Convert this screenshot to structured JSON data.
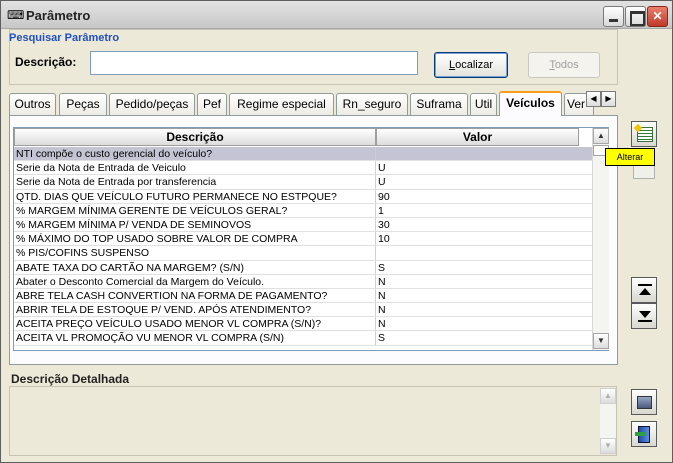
{
  "window": {
    "title": "Parâmetro",
    "icon": "keyboard-icon"
  },
  "search": {
    "caption": "Pesquisar Parâmetro",
    "description_label": "Descrição:",
    "description_value": "",
    "localizar_label": "Localizar",
    "todos_label": "Todos"
  },
  "tabs": [
    {
      "label": "Outros",
      "active": false
    },
    {
      "label": "Peças",
      "active": false
    },
    {
      "label": "Pedido/peças",
      "active": false
    },
    {
      "label": "Pef",
      "active": false
    },
    {
      "label": "Regime especial",
      "active": false
    },
    {
      "label": "Rn_seguro",
      "active": false
    },
    {
      "label": "Suframa",
      "active": false
    },
    {
      "label": "Util",
      "active": false
    },
    {
      "label": "Veículos",
      "active": true
    },
    {
      "label": "Ver",
      "active": false
    }
  ],
  "grid": {
    "columns": [
      "Descrição",
      "Valor"
    ],
    "rows": [
      {
        "descricao": "NTI compõe o custo gerencial do veículo?",
        "valor": "",
        "selected": true
      },
      {
        "descricao": "Serie da Nota de Entrada de Veiculo",
        "valor": "U"
      },
      {
        "descricao": "Serie da Nota de Entrada por transferencia",
        "valor": "U"
      },
      {
        "descricao": "QTD. DIAS QUE VEÍCULO FUTURO PERMANECE NO ESTPQUE?",
        "valor": "90"
      },
      {
        "descricao": "% MARGEM MÍNIMA GERENTE DE VEÍCULOS GERAL?",
        "valor": "1"
      },
      {
        "descricao": "% MARGEM MÍNIMA P/ VENDA DE SEMINOVOS",
        "valor": "30"
      },
      {
        "descricao": "% MÁXIMO DO TOP USADO SOBRE VALOR DE COMPRA",
        "valor": "10"
      },
      {
        "descricao": "% PIS/COFINS SUSPENSO",
        "valor": ""
      },
      {
        "descricao": "ABATE TAXA DO CARTÃO NA MARGEM? (S/N)",
        "valor": "S"
      },
      {
        "descricao": "Abater o Desconto Comercial da Margem do Veículo.",
        "valor": "N"
      },
      {
        "descricao": "ABRE TELA CASH CONVERTION NA FORMA DE PAGAMENTO?",
        "valor": "N"
      },
      {
        "descricao": "ABRIR TELA DE ESTOQUE P/ VEND. APÓS ATENDIMENTO?",
        "valor": "N"
      },
      {
        "descricao": "ACEITA PREÇO VEÍCULO USADO MENOR VL COMPRA (S/N)?",
        "valor": "N"
      },
      {
        "descricao": "ACEITA VL PROMOÇÃO VU MENOR VL COMPRA (S/N)",
        "valor": "S"
      }
    ]
  },
  "side": {
    "tooltip": "Alterar"
  },
  "detail": {
    "label": "Descrição Detalhada",
    "value": ""
  }
}
